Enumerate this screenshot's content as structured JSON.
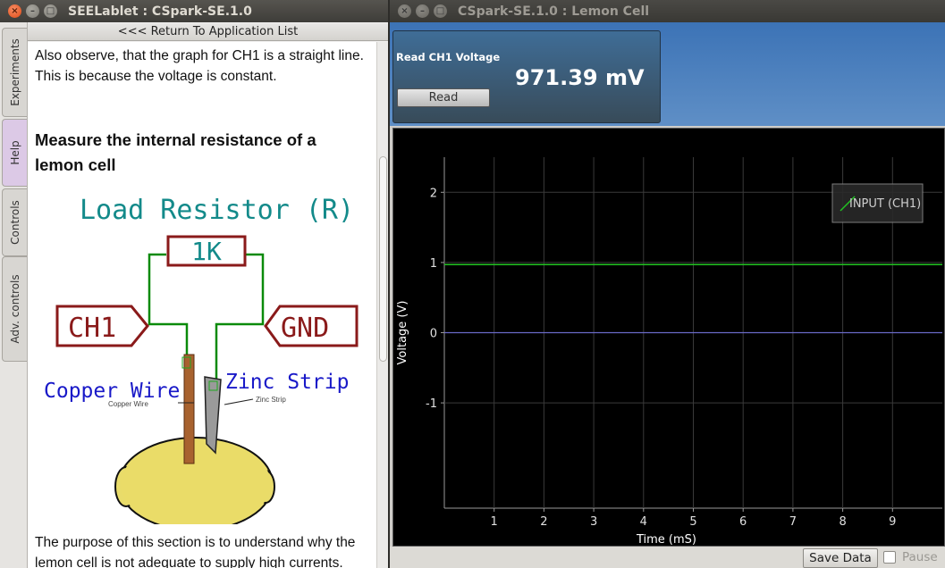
{
  "left_window": {
    "title": "SEELablet : CSpark-SE.1.0",
    "tabs": [
      "Experiments",
      "Help",
      "Controls",
      "Adv. controls"
    ],
    "return_link": "<<< Return To Application List",
    "para1": "Also observe, that the graph for CH1 is a straight line. This is because the voltage is constant.",
    "heading": "Measure the internal resistance of a lemon cell",
    "diagram": {
      "title": "Load Resistor (R)",
      "resistor": "1K",
      "left_terminal": "CH1",
      "right_terminal": "GND",
      "copper_label": "Copper Wire",
      "zinc_label": "Zinc Strip",
      "copper_small": "Copper Wire",
      "zinc_small": "Zinc Strip"
    },
    "para2": "The purpose of this section is to understand why the lemon cell is not adequate to supply high currents."
  },
  "right_window": {
    "title": "CSpark-SE.1.0 : Lemon Cell",
    "panel_title": "Read CH1 Voltage",
    "voltage": "971.39 mV",
    "read_button": "Read",
    "save_button": "Save Data",
    "pause_label": "Pause",
    "pause_checked": false
  },
  "chart_data": {
    "type": "line",
    "xlabel": "Time (mS)",
    "ylabel": "Voltage (V)",
    "xlim": [
      0,
      10
    ],
    "ylim": [
      -2.5,
      2.5
    ],
    "x_ticks": [
      1,
      2,
      3,
      4,
      5,
      6,
      7,
      8,
      9
    ],
    "y_ticks": [
      2,
      1,
      0,
      -1
    ],
    "grid": true,
    "legend_position": "top-right",
    "series": [
      {
        "name": "INPUT (CH1)",
        "color": "#22c322",
        "x": [
          0,
          10
        ],
        "y": [
          0.97,
          0.97
        ]
      }
    ]
  }
}
